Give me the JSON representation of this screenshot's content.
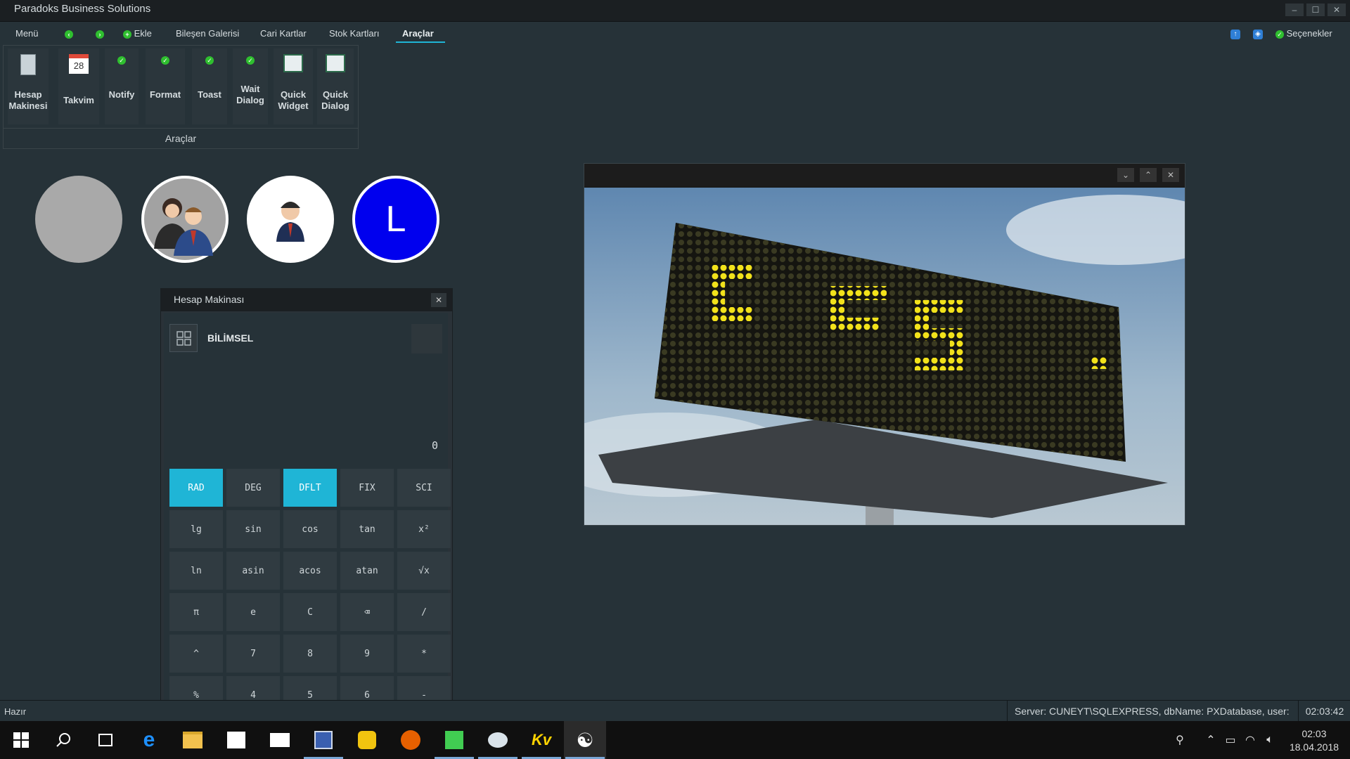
{
  "window": {
    "title": "Paradoks Business Solutions",
    "controls": [
      "–",
      "☐",
      "✕"
    ]
  },
  "menu": {
    "menu_label": "Menü",
    "add_label": "Ekle",
    "tabs": [
      "Bileşen Galerisi",
      "Cari Kartlar",
      "Stok Kartları",
      "Araçlar"
    ],
    "active_tab": "Araçlar",
    "options_label": "Seçenekler"
  },
  "ribbon": {
    "group_label": "Araçlar",
    "buttons": [
      {
        "l1": "Hesap",
        "l2": "Makinesi",
        "icon": "calculator-icon"
      },
      {
        "l1": "Takvim",
        "l2": "",
        "icon": "calendar-icon",
        "date": "28"
      },
      {
        "l1": "Notify",
        "l2": "",
        "icon": "check-icon"
      },
      {
        "l1": "Format",
        "l2": "",
        "icon": "check-icon"
      },
      {
        "l1": "Toast",
        "l2": "",
        "icon": "check-icon"
      },
      {
        "l1": "Wait",
        "l2": "Dialog",
        "icon": "check-icon"
      },
      {
        "l1": "Quick",
        "l2": "Widget",
        "icon": "list-icon"
      },
      {
        "l1": "Quick",
        "l2": "Dialog",
        "icon": "list-icon"
      }
    ]
  },
  "avatars": {
    "letter": "L"
  },
  "image_window": {
    "buttons": [
      "⌄",
      "⌃",
      "✕"
    ]
  },
  "calculator": {
    "title": "Hesap Makinası",
    "mode": "BİLİMSEL",
    "display": "0",
    "keys": [
      "RAD",
      "DEG",
      "DFLT",
      "FIX",
      "SCI",
      "lg",
      "sin",
      "cos",
      "tan",
      "x²",
      "ln",
      "asin",
      "acos",
      "atan",
      "√x",
      "π",
      "e",
      "C",
      "⌫",
      "/",
      "^",
      "7",
      "8",
      "9",
      "*",
      "%",
      "4",
      "5",
      "6",
      "-"
    ],
    "active_keys": [
      "RAD",
      "DFLT"
    ],
    "accent": "#1fb5d6"
  },
  "status": {
    "left": "Hazır",
    "server": "Server: CUNEYT\\SQLEXPRESS, dbName: PXDatabase, user:",
    "clock": "02:03:42"
  },
  "taskbar": {
    "time": "02:03",
    "date": "18.04.2018"
  }
}
